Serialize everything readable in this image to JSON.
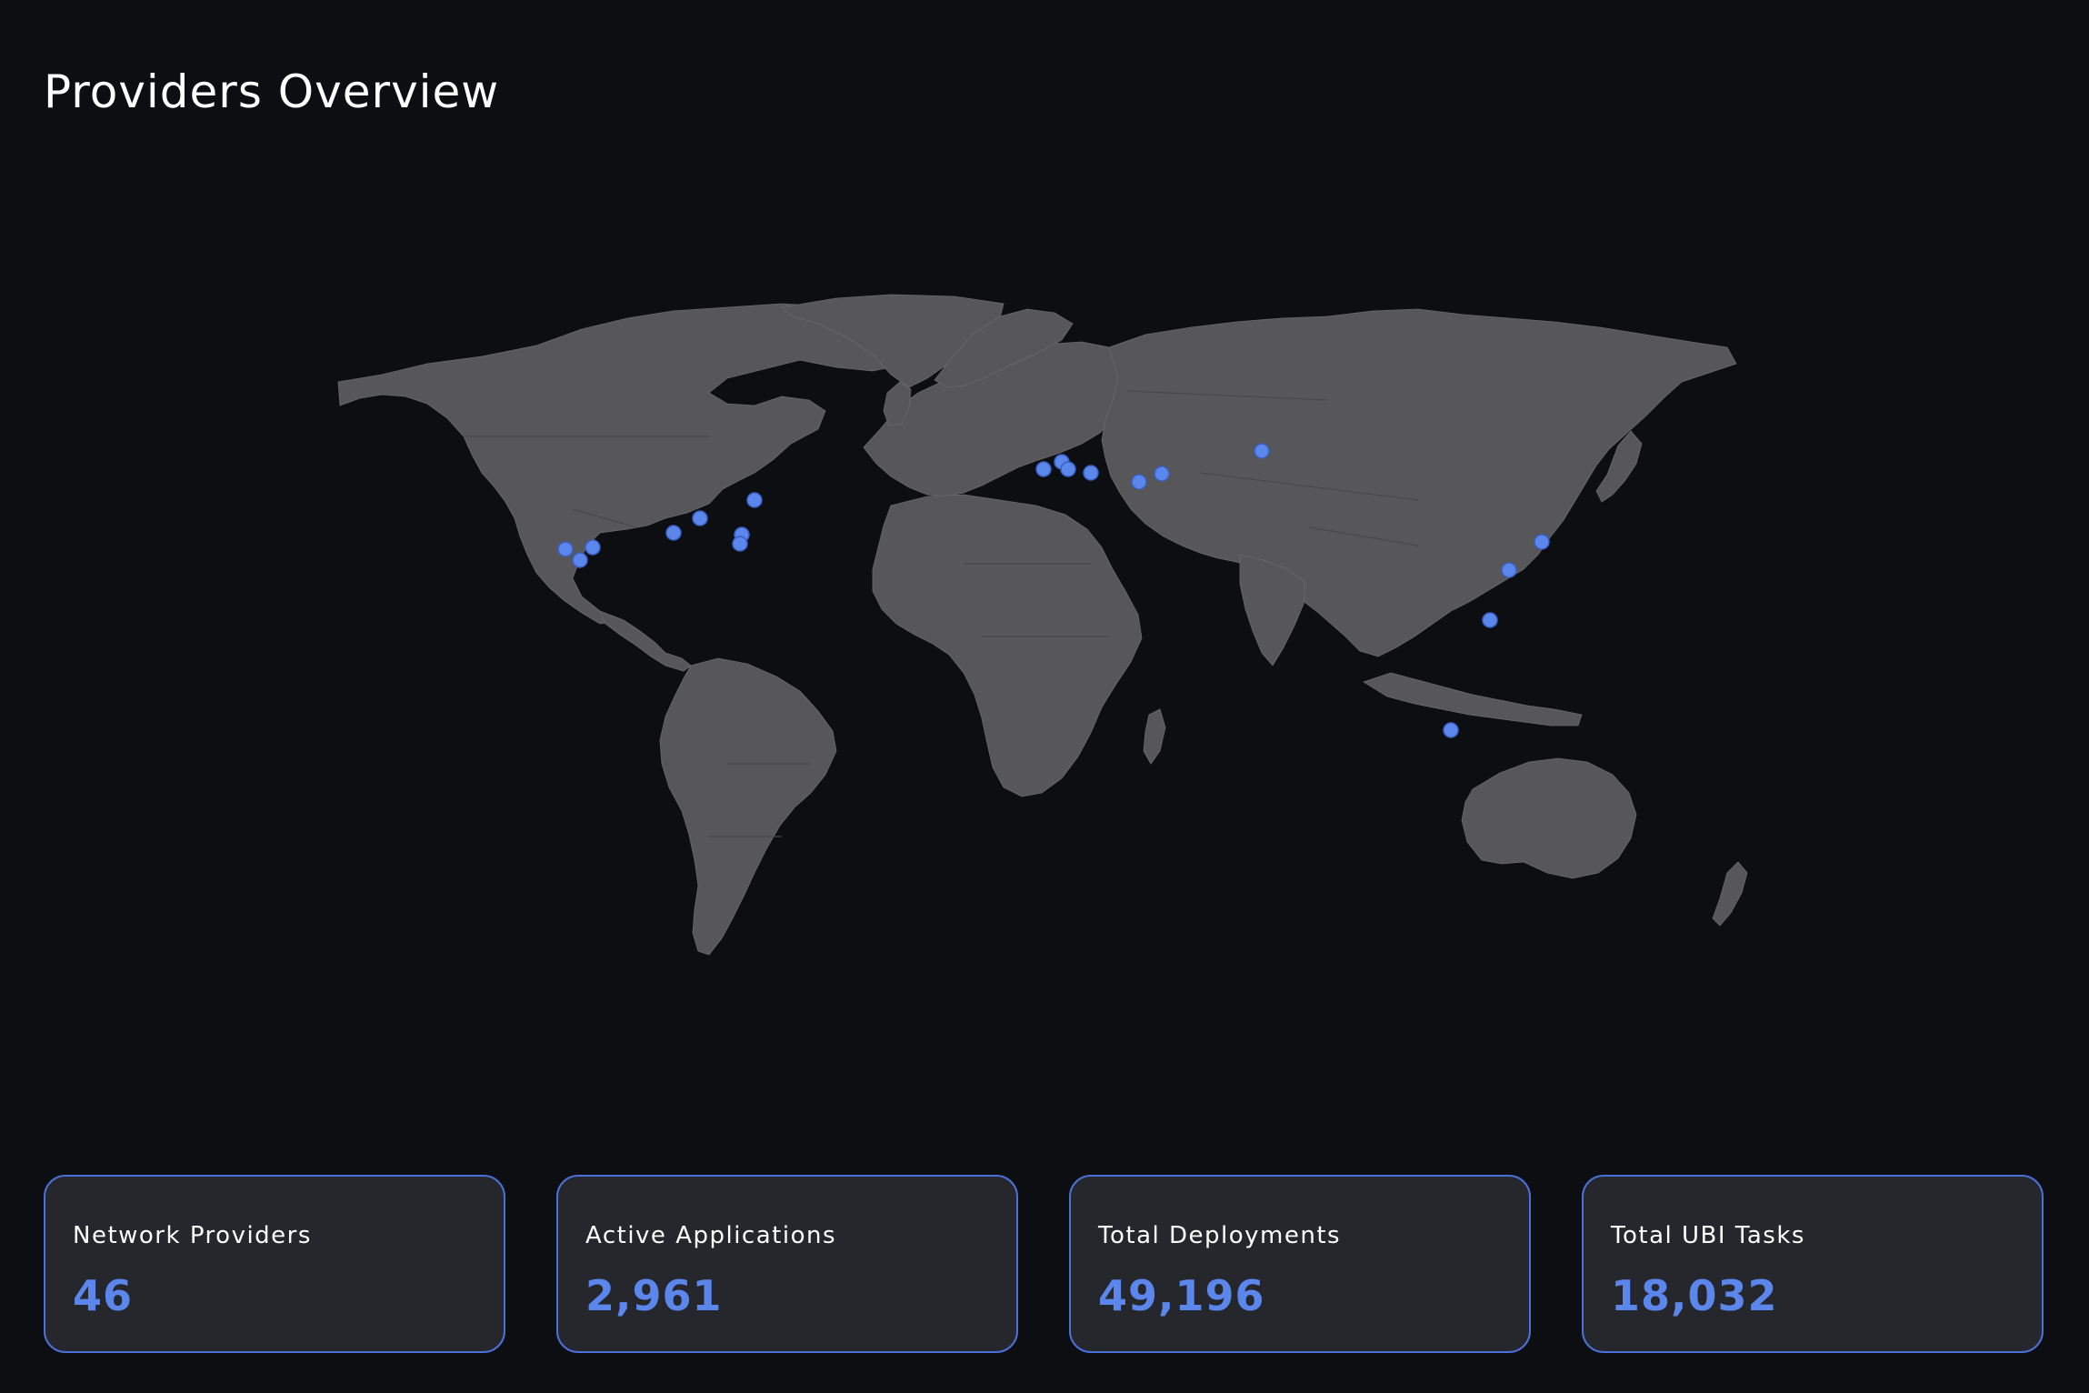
{
  "header": {
    "title": "Providers Overview"
  },
  "map": {
    "land_color": "#575759",
    "marker_color": "#5b86ec",
    "markers": [
      {
        "region": "us-west-1"
      },
      {
        "region": "us-west-2"
      },
      {
        "region": "us-west-3"
      },
      {
        "region": "us-central-1"
      },
      {
        "region": "us-central-2"
      },
      {
        "region": "us-east-1"
      },
      {
        "region": "us-east-2"
      },
      {
        "region": "us-east-3"
      },
      {
        "region": "uk"
      },
      {
        "region": "netherlands"
      },
      {
        "region": "germany-1"
      },
      {
        "region": "germany-2"
      },
      {
        "region": "poland"
      },
      {
        "region": "romania"
      },
      {
        "region": "ukraine"
      },
      {
        "region": "russia"
      },
      {
        "region": "korea"
      },
      {
        "region": "china-east"
      },
      {
        "region": "china-south"
      },
      {
        "region": "singapore"
      }
    ]
  },
  "stats": [
    {
      "label": "Network Providers",
      "value": "46"
    },
    {
      "label": "Active Applications",
      "value": "2,961"
    },
    {
      "label": "Total Deployments",
      "value": "49,196"
    },
    {
      "label": "Total UBI Tasks",
      "value": "18,032"
    }
  ],
  "colors": {
    "background": "#0d0e12",
    "card_background": "#26272c",
    "card_border": "#4b70d9",
    "accent": "#5b86ec"
  }
}
